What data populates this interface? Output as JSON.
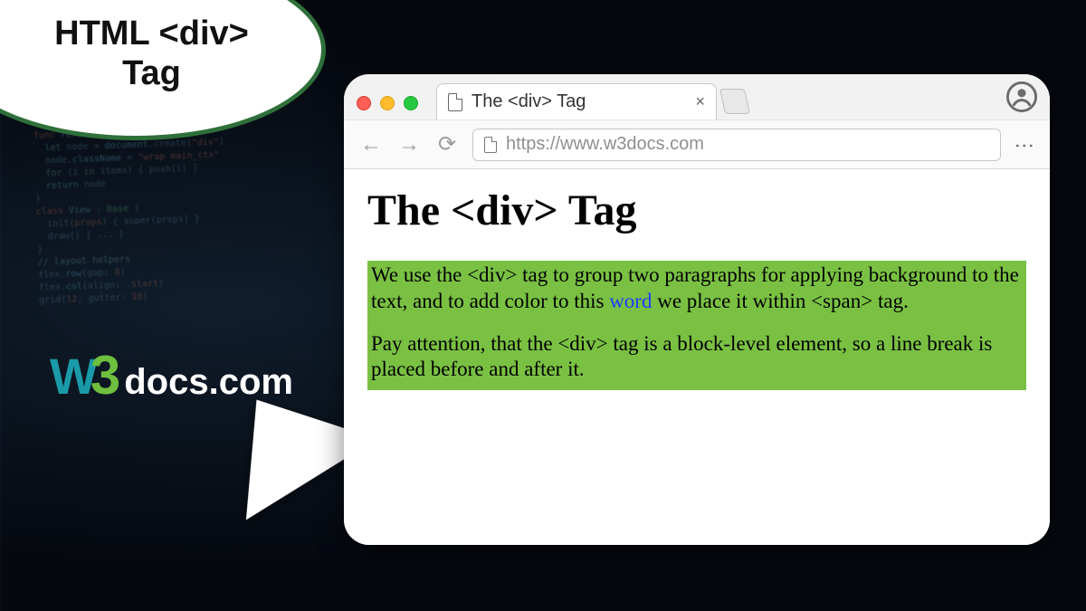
{
  "title_bubble": "HTML <div> Tag",
  "logo": {
    "w": "W",
    "three": "3",
    "docs": "docs",
    "com": ".com"
  },
  "browser": {
    "tab_title": "The <div> Tag",
    "url": "https://www.w3docs.com",
    "page": {
      "heading": "The <div> Tag",
      "para1_a": "We use the <div> tag to group two paragraphs for applying background to the text, and to add color to this ",
      "para1_word": "word",
      "para1_b": " we place it within <span> tag.",
      "para2": "Pay attention, that the <div> tag is a block-level element, so a line break is placed before and after it."
    }
  }
}
